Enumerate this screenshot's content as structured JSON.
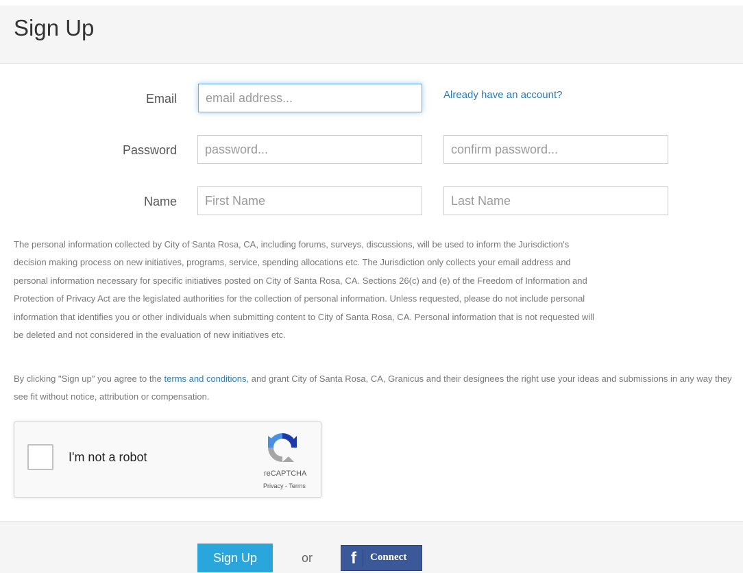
{
  "header": {
    "title": "Sign Up"
  },
  "form": {
    "email_label": "Email",
    "email_placeholder": "email address...",
    "account_link": "Already have an account?",
    "password_label": "Password",
    "password_placeholder": "password...",
    "confirm_placeholder": "confirm password...",
    "name_label": "Name",
    "first_name_placeholder": "First Name",
    "last_name_placeholder": "Last Name"
  },
  "privacy": {
    "lines": [
      "The personal information collected by City of Santa Rosa, CA, including forums, surveys, discussions, will be used to inform the Jurisdiction's",
      "decision making process on new initiatives, programs, service, spending allocations etc. The Jurisdiction only collects your email address and",
      "personal information necessary for specific initiatives posted on City of Santa Rosa, CA. Sections 26(c) and (e) of the Freedom of Information and",
      "Protection of Privacy Act are the legislated authorities for the collection of personal information. Unless requested, please do not include personal",
      "information that identifies you or other individuals when submitting content to City of Santa Rosa, CA. Personal information that is not requested will",
      "be deleted and not considered in the evaluation of new initiatives etc."
    ]
  },
  "agreement": {
    "prefix": "By clicking \"Sign up\" you agree to the ",
    "terms_link": "terms and conditions",
    "suffix": ", and grant City of Santa Rosa, CA, Granicus and their designees the right use your ideas and submissions in any way they see fit without notice, attribution or compensation."
  },
  "captcha": {
    "label": "I'm not a robot",
    "brand": "reCAPTCHA",
    "privacy": "Privacy",
    "separator": " - ",
    "terms": "Terms"
  },
  "footer": {
    "signup_label": "Sign Up",
    "or_text": "or",
    "facebook_icon": "f",
    "facebook_label": "Connect"
  },
  "colors": {
    "link": "#2a7bb7",
    "signup_button": "#2aa6dd",
    "facebook_button": "#3b5998",
    "focus_border": "#66afe9"
  }
}
